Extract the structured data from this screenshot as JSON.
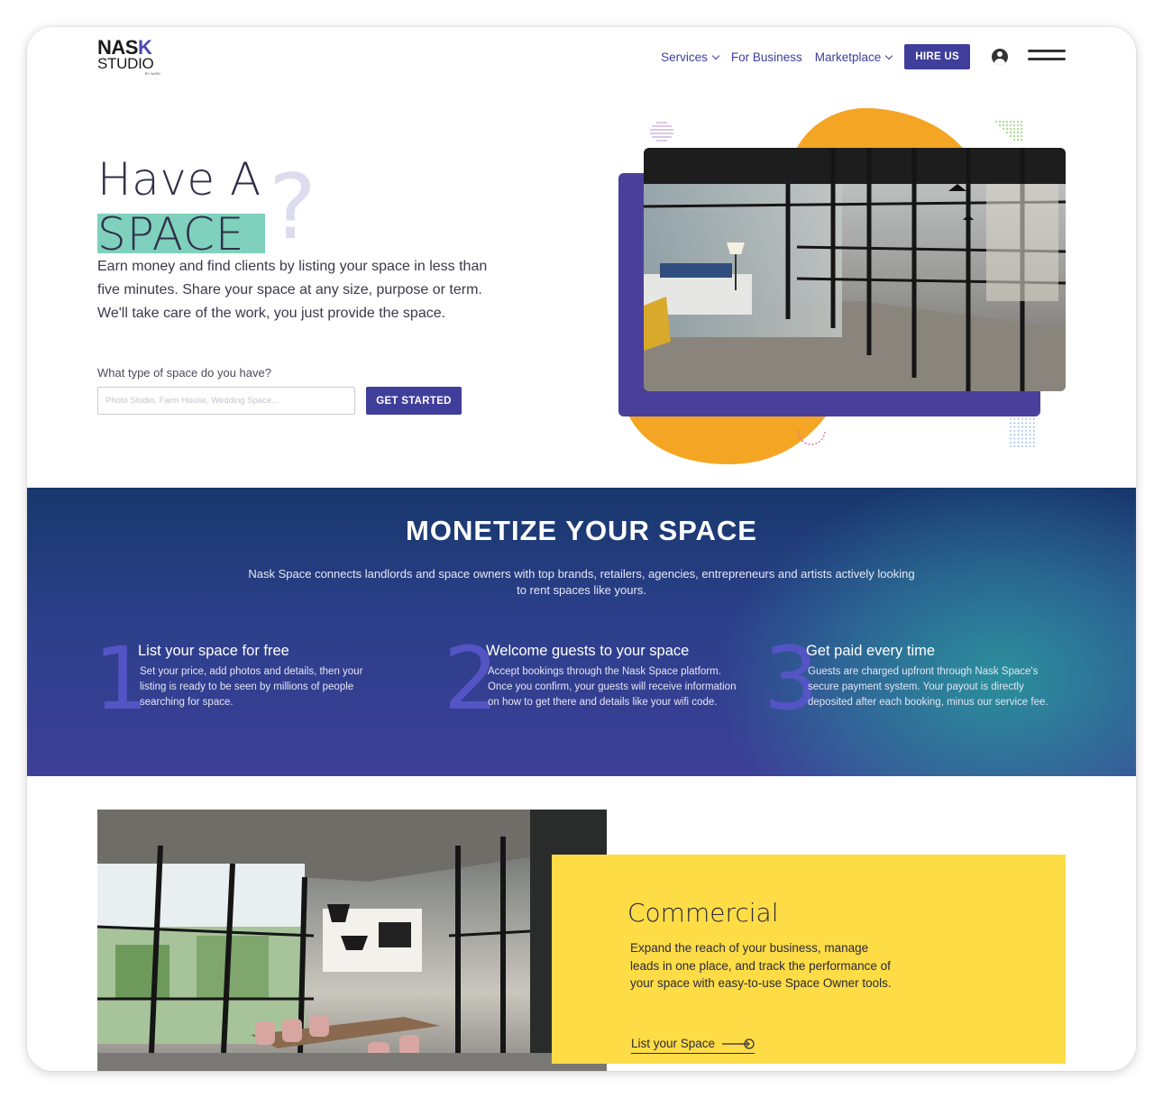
{
  "brand": {
    "logo_top": "NAS",
    "logo_mark": "K",
    "logo_bottom": "STUDIO",
    "logo_tiny": "BY NASK",
    "primary_color": "#3f3f9b",
    "accent_orange": "#f5a524",
    "accent_teal": "#7fd1bd",
    "accent_yellow": "#fddc46"
  },
  "nav": {
    "items": [
      {
        "label": "Services",
        "has_dropdown": true
      },
      {
        "label": "For Business",
        "has_dropdown": false
      },
      {
        "label": "Marketplace",
        "has_dropdown": true
      }
    ],
    "hire_label": "HIRE US",
    "user_icon": "user-circle-icon",
    "menu_icon": "hamburger-menu-icon"
  },
  "hero": {
    "title_line1": "Have A",
    "title_line2": "SPACE",
    "question_mark": "?",
    "description": "Earn money and find clients by listing your space in less than five minutes. Share your space at any size, purpose or term. We'll take care of the work, you just provide the space.",
    "question": "What type of space do you have?",
    "input_placeholder": "Photo Studio, Farm House, Wedding Space...",
    "input_value": "",
    "cta_label": "GET STARTED"
  },
  "monetize": {
    "title": "MONETIZE YOUR SPACE",
    "subtitle": "Nask Space connects landlords and space owners with top brands, retailers, agencies, entrepreneurs and artists actively looking to rent spaces like yours.",
    "steps": [
      {
        "number": "1",
        "title": "List your space for free",
        "description": "Set your price, add photos and details, then your listing is ready to be seen by millions of people searching for space."
      },
      {
        "number": "2",
        "title": "Welcome guests to your space",
        "description": "Accept bookings through the Nask Space platform. Once you confirm, your guests will receive information on how to get there and details like your wifi code."
      },
      {
        "number": "3",
        "title": "Get paid every time",
        "description": "Guests are charged upfront through  Nask Space's secure payment system. Your payout is directly deposited after each booking, minus our service fee."
      }
    ]
  },
  "commercial": {
    "title": "Commercial",
    "description": "Expand the reach of your business, manage leads in one place, and track the performance of your space with easy-to-use Space Owner tools.",
    "link_label": "List your Space",
    "link_icon": "arrow-right-circle-icon"
  }
}
